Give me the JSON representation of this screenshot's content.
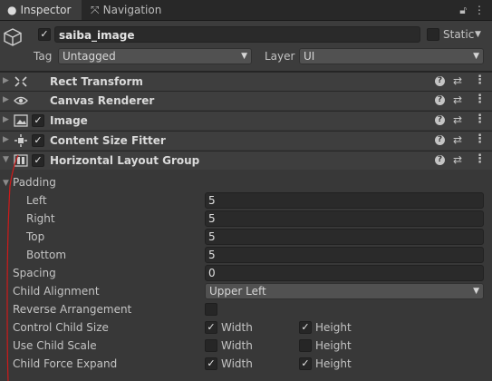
{
  "tabs": {
    "inspector": {
      "label": "Inspector",
      "icon": "info-icon"
    },
    "navigation": {
      "label": "Navigation",
      "icon": "navigation-icon"
    }
  },
  "top_icons": {
    "lock": "lock-icon",
    "menu": "kebab-menu-icon"
  },
  "header": {
    "object_name": "saiba_image",
    "active": true,
    "static_label": "Static",
    "static_checked": false,
    "tag_label": "Tag",
    "tag_value": "Untagged",
    "layer_label": "Layer",
    "layer_value": "UI"
  },
  "components": [
    {
      "title": "Rect Transform",
      "icon": "rect-transform-icon",
      "has_checkbox": false,
      "expanded": false
    },
    {
      "title": "Canvas Renderer",
      "icon": "eye-icon",
      "has_checkbox": false,
      "expanded": false
    },
    {
      "title": "Image",
      "icon": "image-icon",
      "has_checkbox": true,
      "checked": true,
      "expanded": false
    },
    {
      "title": "Content Size Fitter",
      "icon": "content-size-fitter-icon",
      "has_checkbox": true,
      "checked": true,
      "expanded": false
    },
    {
      "title": "Horizontal Layout Group",
      "icon": "horizontal-layout-icon",
      "has_checkbox": true,
      "checked": true,
      "expanded": true
    }
  ],
  "layout_group": {
    "padding_label": "Padding",
    "padding": {
      "left_label": "Left",
      "left": "5",
      "right_label": "Right",
      "right": "5",
      "top_label": "Top",
      "top": "5",
      "bottom_label": "Bottom",
      "bottom": "5"
    },
    "spacing_label": "Spacing",
    "spacing": "0",
    "child_alignment_label": "Child Alignment",
    "child_alignment": "Upper Left",
    "reverse_label": "Reverse Arrangement",
    "reverse": false,
    "control_child_size_label": "Control Child Size",
    "control_child_size": {
      "width": true,
      "height": true
    },
    "use_child_scale_label": "Use Child Scale",
    "use_child_scale": {
      "width": false,
      "height": false
    },
    "child_force_expand_label": "Child Force Expand",
    "child_force_expand": {
      "width": true,
      "height": true
    },
    "width_label": "Width",
    "height_label": "Height"
  },
  "colors": {
    "background": "#383838",
    "header": "#3c3c3c",
    "field": "#2a2a2a",
    "annotation_line": "#d01a1a"
  }
}
